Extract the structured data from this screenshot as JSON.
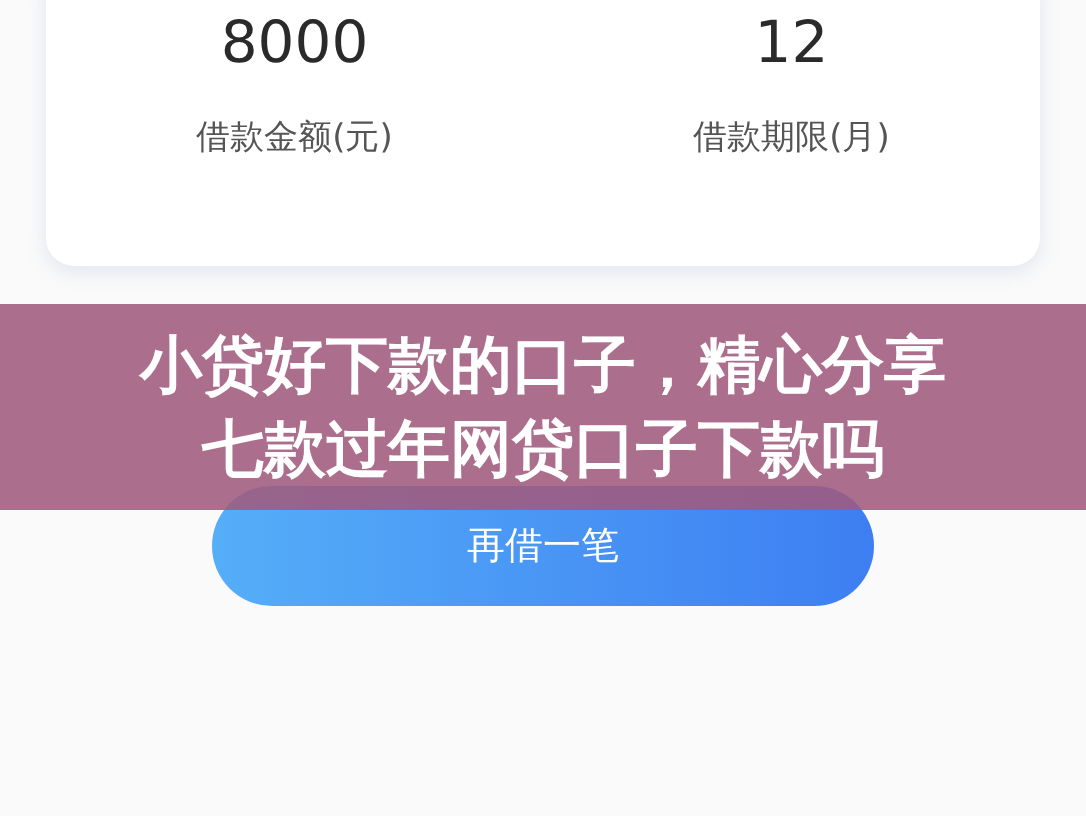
{
  "summary": {
    "items": [
      {
        "value": "8000",
        "label": "借款金额(元)"
      },
      {
        "value": "12",
        "label": "借款期限(月)"
      }
    ]
  },
  "banner": {
    "lines": [
      "小贷好下款的口子，精心分享",
      "七款过年网贷口子下款吗"
    ]
  },
  "action_button": {
    "label": "再借一笔"
  }
}
